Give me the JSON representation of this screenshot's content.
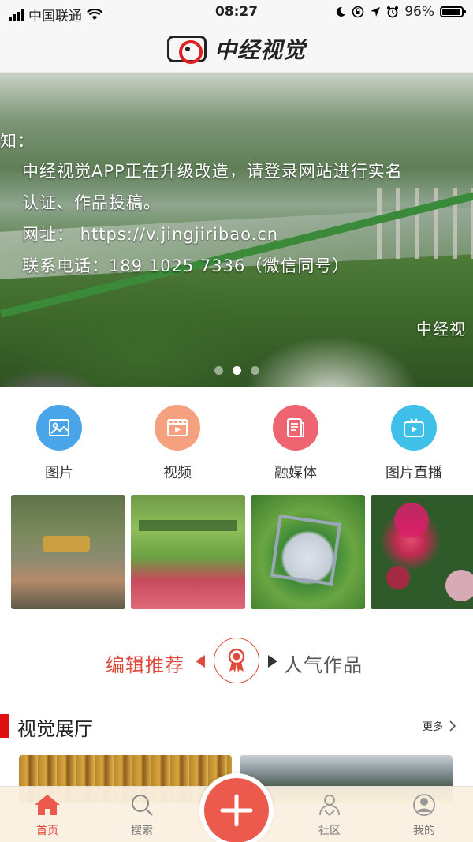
{
  "status_bar": {
    "carrier": "中国联通",
    "time": "08:27",
    "battery": "96%"
  },
  "header": {
    "app_name": "中经视觉"
  },
  "banner": {
    "lines": [
      "知：",
      "中经视觉APP正在升级改造，请登录网站进行实名",
      "认证、作品投稿。",
      "网址： https://v.jingjiribao.cn",
      "联系电话：189 1025 7336（微信同号）"
    ],
    "watermark": "中经视",
    "slide_count": 3,
    "active_slide": 2
  },
  "categories": [
    {
      "label": "图片",
      "icon": "image-icon",
      "color": "#4aa5e8"
    },
    {
      "label": "视频",
      "icon": "video-icon",
      "color": "#f5a07e"
    },
    {
      "label": "融媒体",
      "icon": "document-icon",
      "color": "#ee6470"
    },
    {
      "label": "图片直播",
      "icon": "tv-play-icon",
      "color": "#3fc0e8"
    }
  ],
  "toggle": {
    "left_label": "编辑推荐",
    "right_label": "人气作品",
    "active": "left"
  },
  "section": {
    "title": "视觉展厅",
    "more": "更多"
  },
  "tabbar": {
    "items": [
      {
        "label": "首页",
        "icon": "home-icon",
        "active": true
      },
      {
        "label": "搜索",
        "icon": "search-icon",
        "active": false
      },
      {
        "label": "社区",
        "icon": "community-icon",
        "active": false
      },
      {
        "label": "我的",
        "icon": "profile-icon",
        "active": false
      }
    ],
    "center_icon": "plus-icon"
  },
  "colors": {
    "accent": "#e04a3c",
    "section_bar": "#e01010"
  }
}
